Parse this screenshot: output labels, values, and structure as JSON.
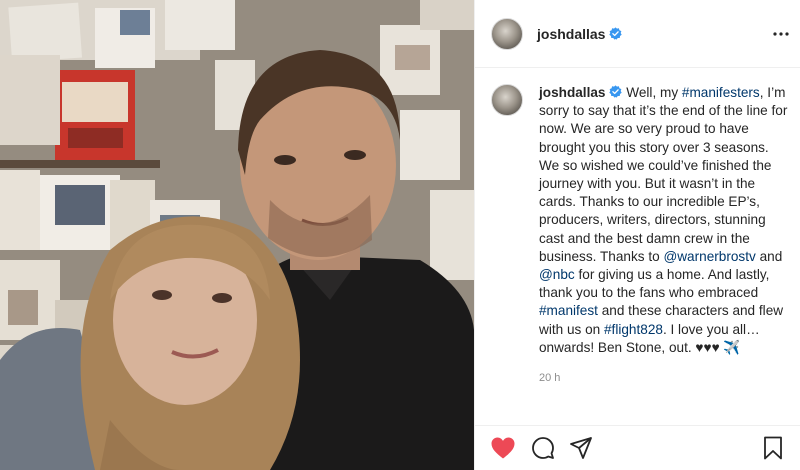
{
  "post": {
    "username": "joshdallas",
    "verified": true,
    "more_icon": "more-horizontal-icon"
  },
  "caption": {
    "username": "joshdallas",
    "segments": [
      {
        "type": "text",
        "value": " Well, my "
      },
      {
        "type": "link",
        "value": "#manifesters"
      },
      {
        "type": "text",
        "value": ", I’m sorry to say that it’s the end of the line for now. We are so very proud to have brought you this story over 3 seasons. We so wished we could’ve finished the journey with you. But it wasn’t in the cards. Thanks to our incredible EP’s, producers, writers, directors, stunning cast and the best damn crew in the business. Thanks to "
      },
      {
        "type": "link",
        "value": "@warnerbrostv"
      },
      {
        "type": "text",
        "value": " and "
      },
      {
        "type": "link",
        "value": "@nbc"
      },
      {
        "type": "text",
        "value": " for giving us a home. And lastly, thank you to the fans who embraced "
      },
      {
        "type": "link",
        "value": "#manifest"
      },
      {
        "type": "text",
        "value": " and these characters and flew with us on "
      },
      {
        "type": "link",
        "value": "#flight828"
      },
      {
        "type": "text",
        "value": ". I love you all… onwards! Ben Stone, out. ♥♥♥ ✈️"
      }
    ],
    "time": "20 h"
  },
  "actions": {
    "like_icon": "heart-filled-icon",
    "like_color": "#ed4956",
    "comment_icon": "comment-icon",
    "share_icon": "send-icon",
    "save_icon": "bookmark-icon"
  },
  "colors": {
    "verified": "#3897f0",
    "link": "#00376b",
    "text": "#262626",
    "muted": "#8e8e8e"
  }
}
